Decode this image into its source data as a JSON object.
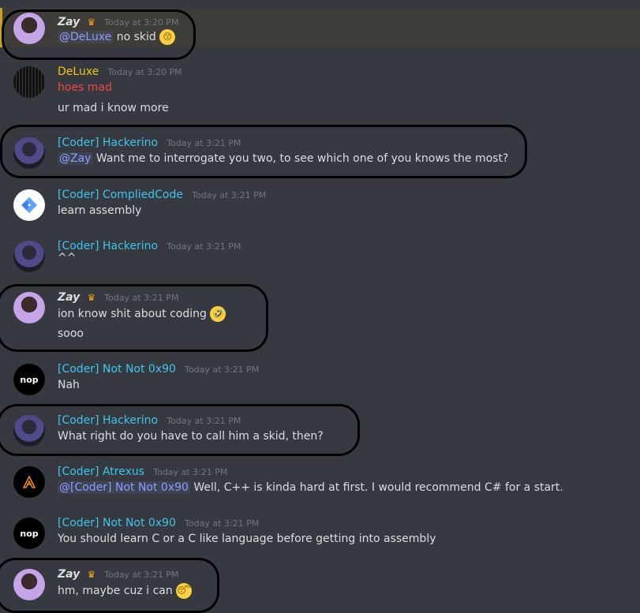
{
  "messages": [
    {
      "author": "Zay",
      "crown": true,
      "time": "Today at 3:20 PM",
      "lines": [
        {
          "mention": "@DeLuxe",
          "text": " no skid",
          "emoji": "kissing-face-emoji"
        }
      ]
    },
    {
      "author": "DeLuxe",
      "time": "Today at 3:20 PM",
      "lines": [
        {
          "text": "hoes mad",
          "red": true
        },
        {
          "text": "ur mad i know more"
        }
      ]
    },
    {
      "author": "[Coder] Hackerino",
      "time": "Today at 3:21 PM",
      "lines": [
        {
          "mention": "@Zay",
          "text": " Want me to interrogate you two, to see which one of you knows the most?"
        }
      ]
    },
    {
      "author": "[Coder] CompliedCode",
      "time": "Today at 3:21 PM",
      "lines": [
        {
          "text": "learn assembly"
        }
      ]
    },
    {
      "author": "[Coder] Hackerino",
      "time": "Today at 3:21 PM",
      "lines": [
        {
          "text": "^^"
        }
      ]
    },
    {
      "author": "Zay",
      "crown": true,
      "time": "Today at 3:21 PM",
      "lines": [
        {
          "text": "ion know shit about coding",
          "emoji": "rofl-emoji"
        },
        {
          "text": "sooo"
        }
      ]
    },
    {
      "author": "[Coder] Not Not 0x90",
      "time": "Today at 3:21 PM",
      "avatar_text": "nop",
      "lines": [
        {
          "text": "Nah"
        }
      ]
    },
    {
      "author": "[Coder] Hackerino",
      "time": "Today at 3:21 PM",
      "lines": [
        {
          "text": "What right do you have to call him a skid, then?"
        }
      ]
    },
    {
      "author": "[Coder] Atrexus",
      "time": "Today at 3:21 PM",
      "lines": [
        {
          "mention": "@[Coder] Not Not 0x90",
          "text": " Well, C++ is kinda hard at first. I would recommend C# for a start."
        }
      ]
    },
    {
      "author": "[Coder] Not Not 0x90",
      "time": "Today at 3:21 PM",
      "avatar_text": "nop",
      "lines": [
        {
          "text": "You should learn C or a C like language before getting into assembly"
        }
      ]
    },
    {
      "author": "Zay",
      "crown": true,
      "time": "Today at 3:21 PM",
      "lines": [
        {
          "text": "hm, maybe cuz i can",
          "emoji": "sleepy-face-emoji"
        }
      ]
    }
  ],
  "icons": {
    "crown": "♛",
    "kiss": "😙",
    "rofl": "🤣",
    "sleepy": "😴",
    "compiled": "compiled-code-logo",
    "atrexus": "atrexus-logo"
  },
  "colors": {
    "background": "#36393f",
    "coder_role": "#3cc6ef",
    "deluxe_role": "#f1c40f",
    "mention": "#8c9eff",
    "timestamp": "#72767d",
    "highlight_bar": "#c9a21c"
  }
}
